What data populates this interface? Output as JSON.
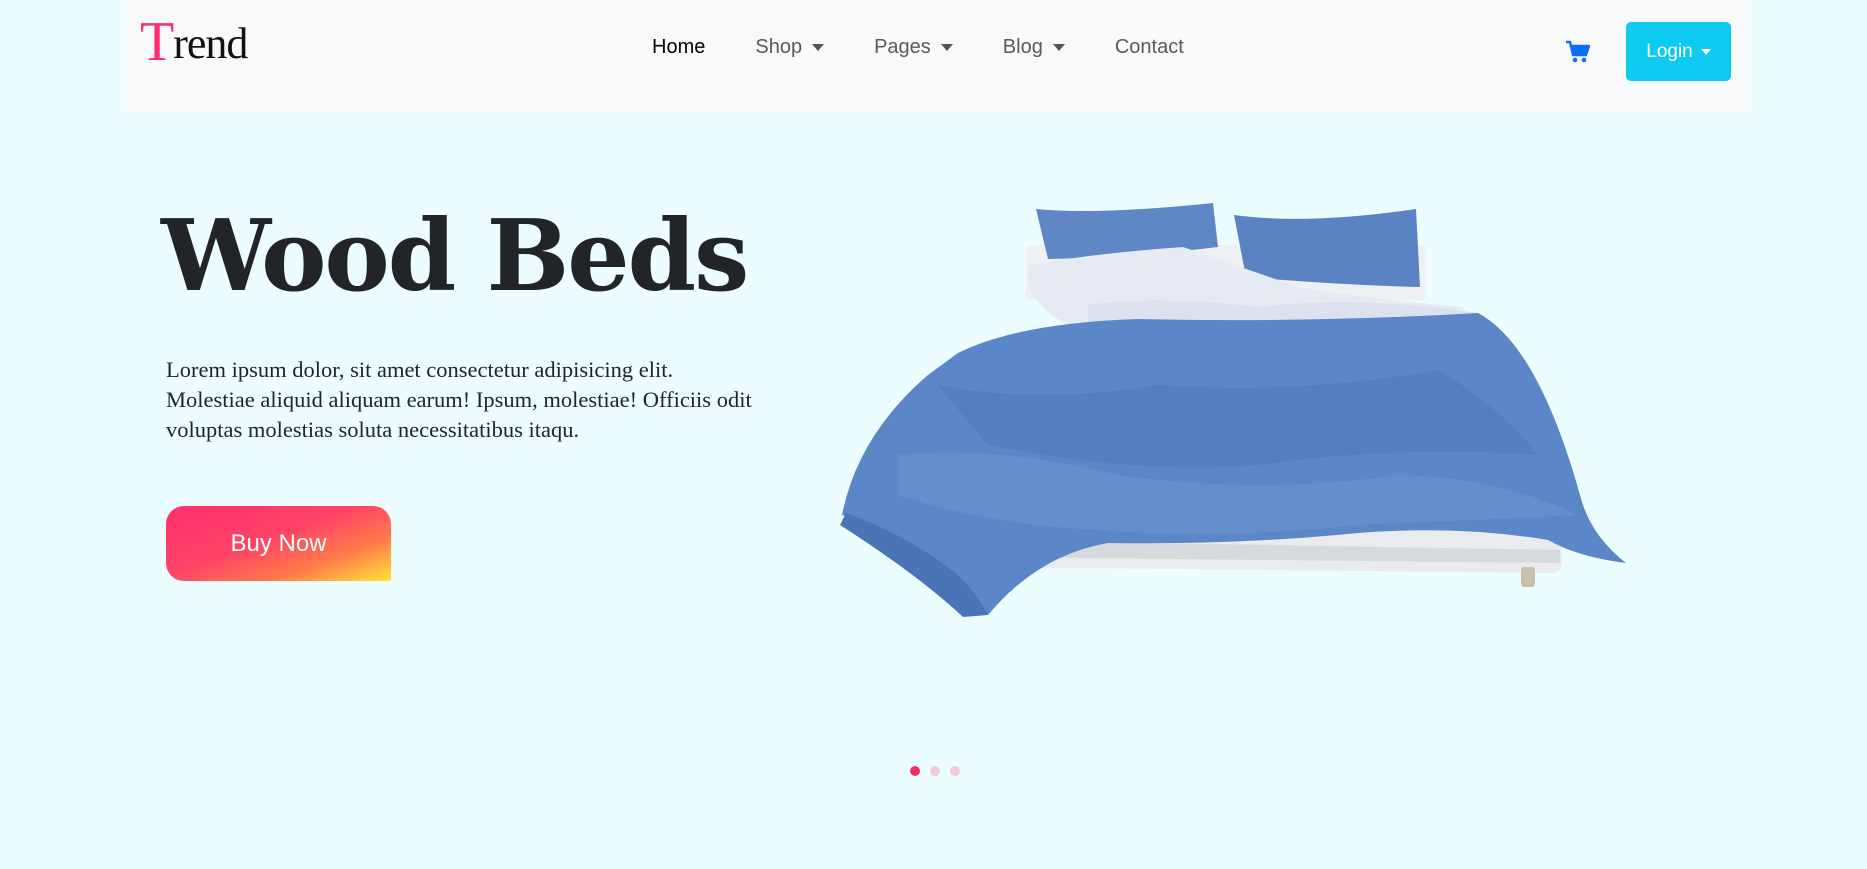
{
  "brand": {
    "first_letter": "T",
    "rest": "rend"
  },
  "nav": {
    "home": "Home",
    "shop": "Shop",
    "pages": "Pages",
    "blog": "Blog",
    "contact": "Contact"
  },
  "cart_icon": "cart-icon",
  "login_label": "Login",
  "hero": {
    "title": "Wood Beds",
    "text": "Lorem ipsum dolor, sit amet consectetur adipisicing elit. Molestiae aliquid aliquam earum! Ipsum, molestiae! Officiis odit voluptas molestias soluta necessitatibus itaqu.",
    "button": "Buy Now",
    "image": "bed-image"
  },
  "carousel": {
    "active_index": 0,
    "count": 3
  },
  "colors": {
    "background": "#ebfdfe",
    "navbar": "#f8f9fa",
    "brand_accent": "#ff2d6f",
    "login": "#0dcaf0",
    "cart": "#0d6efd",
    "dot_active": "#ee2d68",
    "dot_inactive": "#f3c9d9"
  }
}
